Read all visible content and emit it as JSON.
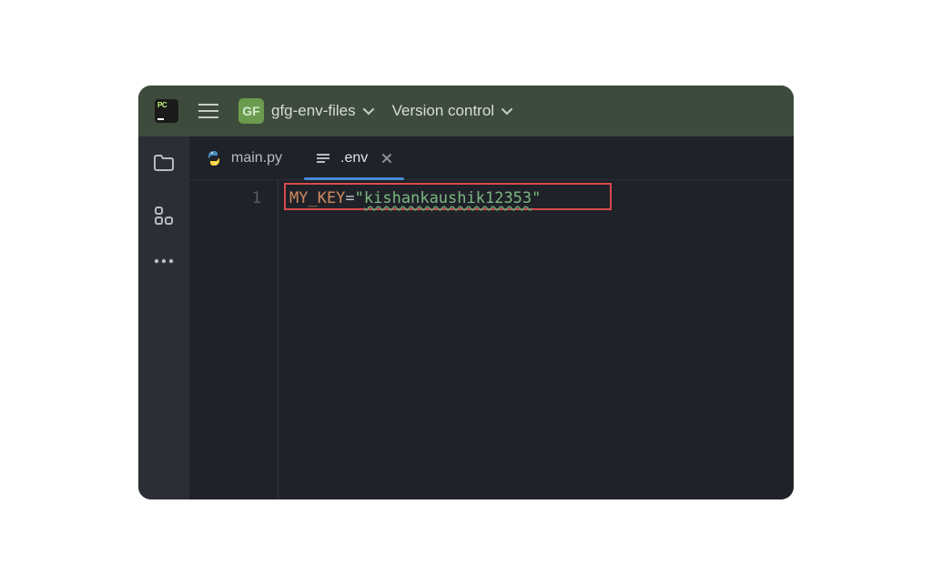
{
  "app": {
    "icon_text": "PC"
  },
  "title_bar": {
    "project_badge": "GF",
    "project_name": "gfg-env-files",
    "version_control": "Version control"
  },
  "tabs": [
    {
      "label": "main.py",
      "icon": "python",
      "active": false,
      "closeable": false
    },
    {
      "label": ".env",
      "icon": "generic",
      "active": true,
      "closeable": true
    }
  ],
  "editor": {
    "line_numbers": [
      "1"
    ],
    "code": {
      "key": "MY_KEY",
      "op": "=",
      "q": "\"",
      "value": "kishankaushik12353"
    }
  }
}
